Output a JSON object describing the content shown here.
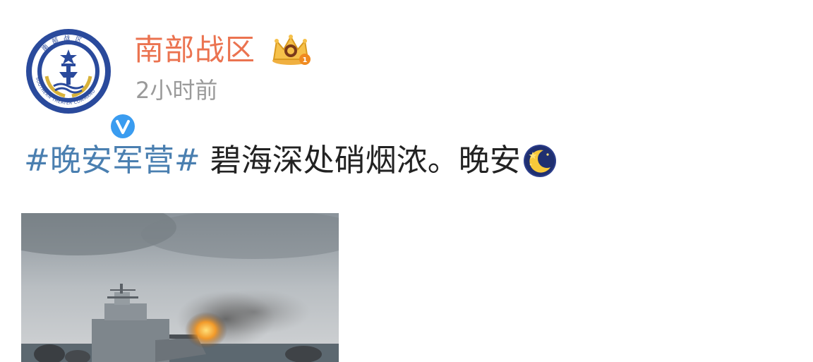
{
  "author": {
    "name": "南部战区",
    "post_time": "2小时前",
    "avatar_icon": "southern-theater-command-emblem",
    "avatar_ring_text": "南 部 战 区",
    "avatar_ring_en": "SOUTHERN THEATER COMMAND",
    "badge_icon": "verified-v-icon",
    "vip_icon": "vip-crown-icon",
    "name_color": "#eb7350"
  },
  "post": {
    "hashtag": "#晚安军营#",
    "text": "碧海深处硝烟浓。晚安",
    "emoji": "moon-emoji",
    "hashtag_color": "#4a7fb0"
  },
  "media": {
    "type": "photo",
    "subject": "warship-firing-gun-at-sea"
  }
}
